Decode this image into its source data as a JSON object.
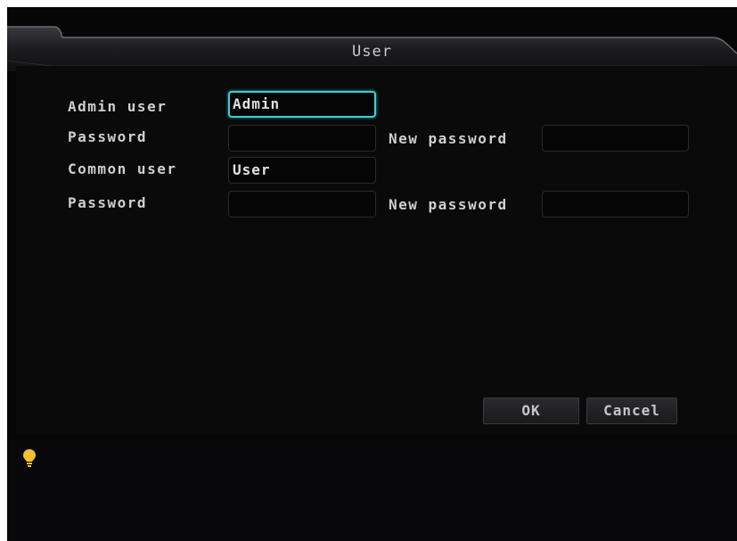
{
  "window": {
    "title": "User"
  },
  "form": {
    "admin_user_label": "Admin user",
    "admin_user_value": "Admin",
    "admin_password_label": "Password",
    "admin_password_value": "",
    "admin_new_password_label": "New password",
    "admin_new_password_value": "",
    "common_user_label": "Common user",
    "common_user_value": "User",
    "common_password_label": "Password",
    "common_password_value": "",
    "common_new_password_label": "New password",
    "common_new_password_value": ""
  },
  "buttons": {
    "ok": "OK",
    "cancel": "Cancel"
  },
  "footer": {
    "hint_icon": "lightbulb-icon"
  },
  "colors": {
    "focus_border": "#3ccfd0",
    "bulb": "#f5c030"
  }
}
